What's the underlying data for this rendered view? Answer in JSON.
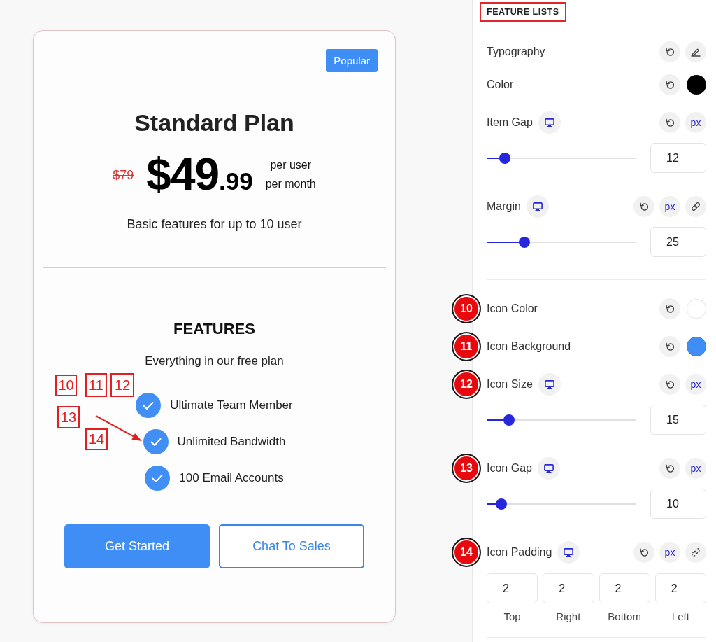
{
  "card": {
    "badge": "Popular",
    "title": "Standard Plan",
    "old_price": "$79",
    "price": "$49",
    "price_cents": ".99",
    "period": [
      "per user",
      "per month"
    ],
    "description": "Basic features for up to 10 user",
    "features_title": "FEATURES",
    "features_intro": "Everything in our free plan",
    "features": [
      "Ultimate Team Member",
      "Unlimited Bandwidth",
      "100 Email Accounts"
    ],
    "buttons": [
      {
        "label": "Get Started",
        "kind": "primary"
      },
      {
        "label": "Chat To Sales",
        "kind": "outline"
      }
    ]
  },
  "callouts": [
    {
      "text": "10"
    },
    {
      "text": "11"
    },
    {
      "text": "12"
    },
    {
      "text": "13"
    },
    {
      "text": "14"
    }
  ],
  "panel": {
    "title": "FEATURE LISTS",
    "groups": [
      {
        "controls": [
          {
            "label": "Typography",
            "kind": "typography",
            "responsive": false
          },
          {
            "label": "Color",
            "kind": "color",
            "responsive": false,
            "color": "#000000"
          },
          {
            "label": "Item Gap",
            "kind": "slider",
            "responsive": true,
            "unit": "px",
            "level": 0.12,
            "value": "12"
          },
          {
            "label": "Margin",
            "kind": "slider",
            "responsive": true,
            "unit": "px",
            "linked": true,
            "level": 0.25,
            "value": "25"
          }
        ]
      },
      {
        "controls": [
          {
            "label": "Icon Color",
            "kind": "color",
            "responsive": false,
            "color": "#ffffff",
            "marker": "10"
          },
          {
            "label": "Icon Background",
            "kind": "color",
            "responsive": false,
            "color": "#3f8ef5",
            "marker": "11"
          },
          {
            "label": "Icon Size",
            "kind": "slider",
            "responsive": true,
            "unit": "px",
            "level": 0.15,
            "value": "15",
            "marker": "12"
          },
          {
            "label": "Icon Gap",
            "kind": "slider",
            "responsive": true,
            "unit": "px",
            "level": 0.1,
            "value": "10",
            "marker": "13"
          },
          {
            "label": "Icon Padding",
            "kind": "dimensions",
            "responsive": true,
            "unit": "px",
            "linked": false,
            "marker": "14",
            "sides": [
              {
                "label": "Top",
                "value": "2"
              },
              {
                "label": "Right",
                "value": "2"
              },
              {
                "label": "Bottom",
                "value": "2"
              },
              {
                "label": "Left",
                "value": "2"
              }
            ]
          }
        ]
      }
    ]
  }
}
